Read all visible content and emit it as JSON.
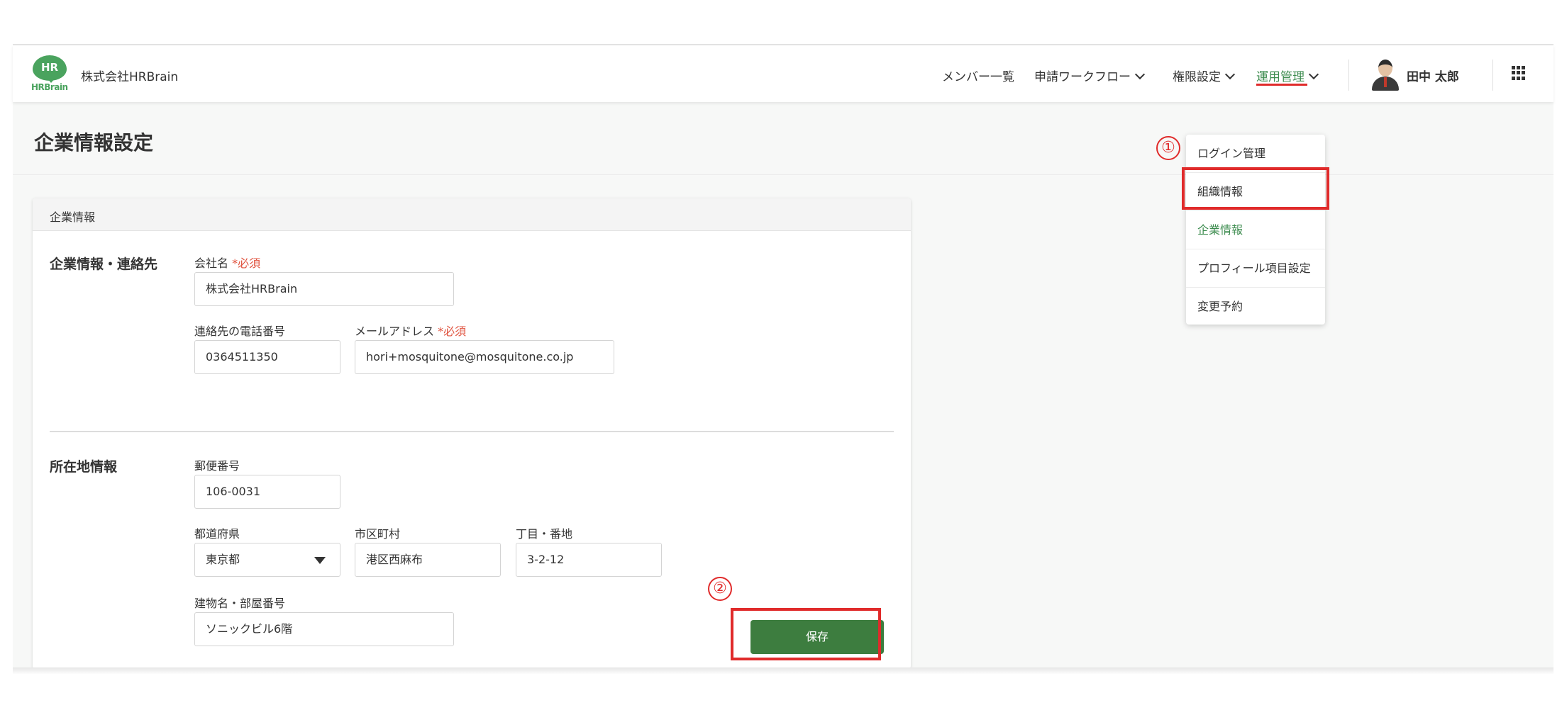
{
  "header": {
    "logo_text": "HRBrain",
    "logo_badge": "HR",
    "company_name": "株式会社HRBrain",
    "nav": [
      {
        "label": "メンバー一覧"
      },
      {
        "label": "申請ワークフロー"
      },
      {
        "label": "権限設定"
      },
      {
        "label": "運用管理"
      }
    ],
    "user_name": "田中 太郎"
  },
  "dropdown": {
    "items": [
      {
        "label": "ログイン管理"
      },
      {
        "label": "組織情報"
      },
      {
        "label": "企業情報"
      },
      {
        "label": "プロフィール項目設定"
      },
      {
        "label": "変更予約"
      }
    ],
    "active_index": 2
  },
  "page": {
    "title": "企業情報設定"
  },
  "card": {
    "header": "企業情報",
    "contact_section": {
      "title": "企業情報・連絡先",
      "company_name_label": "会社名",
      "required_mark": "*必須",
      "company_name_value": "株式会社HRBrain",
      "phone_label": "連絡先の電話番号",
      "phone_value": "0364511350",
      "email_label": "メールアドレス",
      "email_value": "hori+mosquitone@mosquitone.co.jp"
    },
    "address_section": {
      "title": "所在地情報",
      "postal_label": "郵便番号",
      "postal_value": "106-0031",
      "prefecture_label": "都道府県",
      "prefecture_value": "東京都",
      "city_label": "市区町村",
      "city_value": "港区西麻布",
      "street_label": "丁目・番地",
      "street_value": "3-2-12",
      "building_label": "建物名・部屋番号",
      "building_value": "ソニックビル6階"
    },
    "save_label": "保存"
  },
  "annotations": {
    "step1": "①",
    "step2": "②",
    "color": "#e02b2b"
  },
  "colors": {
    "brand_green": "#4aa35e",
    "active_green": "#3d8c4f",
    "save_button": "#3d7d3f",
    "required": "#e0533f"
  }
}
